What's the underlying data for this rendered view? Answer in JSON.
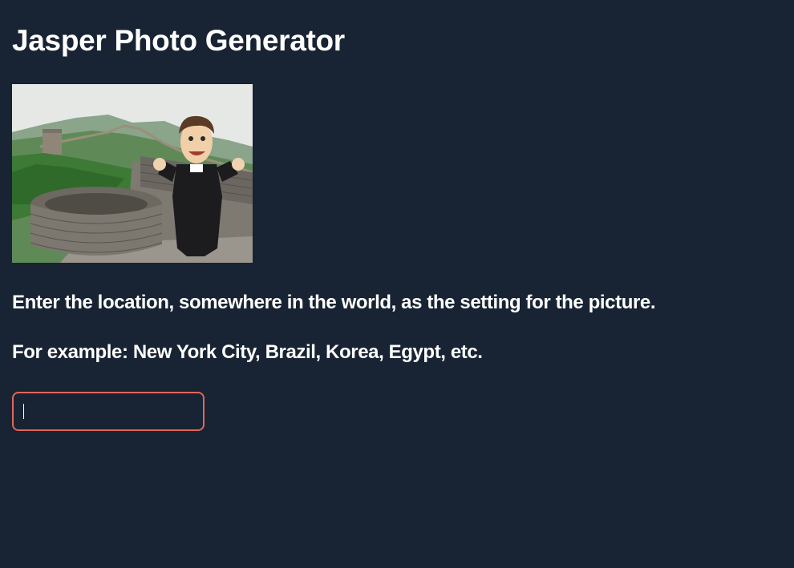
{
  "page": {
    "title": "Jasper Photo Generator"
  },
  "photo": {
    "description": "mascot-on-great-wall"
  },
  "instructions": {
    "line1": "Enter the location, somewhere in the world, as the setting for the picture.",
    "line2": "For example: New York City, Brazil, Korea, Egypt, etc."
  },
  "location_input": {
    "value": "",
    "placeholder": ""
  },
  "colors": {
    "background": "#182333",
    "text": "#ffffff",
    "input_border": "#e0675a"
  }
}
